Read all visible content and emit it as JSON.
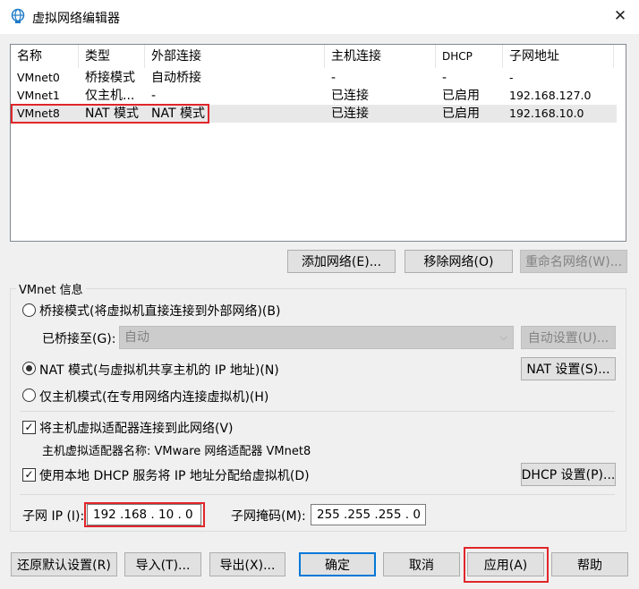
{
  "window": {
    "title": "虚拟网络编辑器",
    "close_glyph": "✕"
  },
  "list": {
    "headers": [
      "名称",
      "类型",
      "外部连接",
      "主机连接",
      "DHCP",
      "子网地址"
    ],
    "rows": [
      [
        "VMnet0",
        "桥接模式",
        "自动桥接",
        "-",
        "-",
        "-"
      ],
      [
        "VMnet1",
        "仅主机...",
        "-",
        "已连接",
        "已启用",
        "192.168.127.0"
      ],
      [
        "VMnet8",
        "NAT 模式",
        "NAT 模式",
        "已连接",
        "已启用",
        "192.168.10.0"
      ]
    ],
    "selected_row": 2
  },
  "list_buttons": {
    "add": "添加网络(E)...",
    "remove": "移除网络(O)",
    "rename": "重命名网络(W)..."
  },
  "group": {
    "label": "VMnet 信息",
    "bridged_label": "桥接模式(将虚拟机直接连接到外部网络)(B)",
    "bridged_to_label": "已桥接至(G):",
    "bridged_to_value": "自动",
    "auto_settings": "自动设置(U)...",
    "nat_label": "NAT 模式(与虚拟机共享主机的 IP 地址)(N)",
    "nat_settings": "NAT 设置(S)...",
    "hostonly_label": "仅主机模式(在专用网络内连接虚拟机)(H)",
    "connect_adapter_label": "将主机虚拟适配器连接到此网络(V)",
    "adapter_name_text": "主机虚拟适配器名称: VMware 网络适配器 VMnet8",
    "dhcp_label": "使用本地 DHCP 服务将 IP 地址分配给虚拟机(D)",
    "dhcp_settings": "DHCP 设置(P)...",
    "subnet_ip_label": "子网 IP (I):",
    "subnet_ip_value": "192 .168 . 10 . 0",
    "subnet_mask_label": "子网掩码(M):",
    "subnet_mask_value": "255 .255 .255 . 0",
    "mode_selected": "nat",
    "connect_adapter_checked": true,
    "dhcp_checked": true,
    "check_glyph": "✓"
  },
  "footer": {
    "restore": "还原默认设置(R)",
    "import": "导入(T)...",
    "export": "导出(X)...",
    "ok": "确定",
    "cancel": "取消",
    "apply": "应用(A)",
    "help": "帮助"
  },
  "colors": {
    "highlight_red": "#e0262a",
    "accent": "#0078d7"
  }
}
